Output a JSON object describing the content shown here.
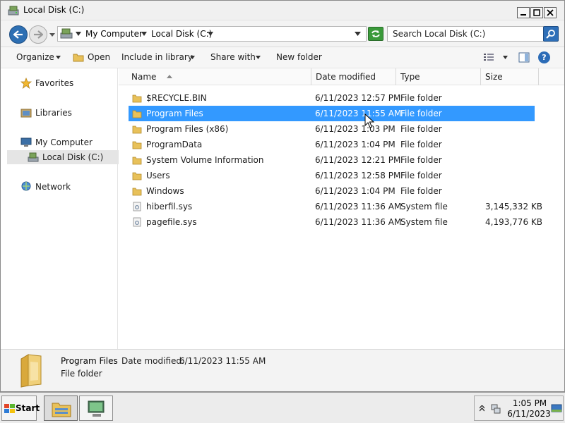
{
  "window": {
    "title": "Local Disk (C:)"
  },
  "address": {
    "crumbs": [
      "My Computer",
      "Local Disk (C:)"
    ],
    "search_placeholder": "Search Local Disk (C:)"
  },
  "toolbar": {
    "organize": "Organize",
    "open": "Open",
    "include_in_library": "Include in library",
    "share_with": "Share with",
    "new_folder": "New folder",
    "help_glyph": "?"
  },
  "nav": {
    "favorites": "Favorites",
    "libraries": "Libraries",
    "my_computer": "My Computer",
    "local_disk": "Local Disk (C:)",
    "network": "Network"
  },
  "columns": {
    "name": "Name",
    "date_modified": "Date modified",
    "type": "Type",
    "size": "Size"
  },
  "files": [
    {
      "name": "$RECYCLE.BIN",
      "date": "6/11/2023 12:57 PM",
      "type": "File folder",
      "size": "",
      "icon": "folder-icon"
    },
    {
      "name": "Program Files",
      "date": "6/11/2023 11:55 AM",
      "type": "File folder",
      "size": "",
      "icon": "folder-icon",
      "selected": true
    },
    {
      "name": "Program Files (x86)",
      "date": "6/11/2023 1:03 PM",
      "type": "File folder",
      "size": "",
      "icon": "folder-icon"
    },
    {
      "name": "ProgramData",
      "date": "6/11/2023 1:04 PM",
      "type": "File folder",
      "size": "",
      "icon": "folder-icon"
    },
    {
      "name": "System Volume Information",
      "date": "6/11/2023 12:21 PM",
      "type": "File folder",
      "size": "",
      "icon": "folder-icon"
    },
    {
      "name": "Users",
      "date": "6/11/2023 12:58 PM",
      "type": "File folder",
      "size": "",
      "icon": "folder-icon"
    },
    {
      "name": "Windows",
      "date": "6/11/2023 1:04 PM",
      "type": "File folder",
      "size": "",
      "icon": "folder-icon"
    },
    {
      "name": "hiberfil.sys",
      "date": "6/11/2023 11:36 AM",
      "type": "System file",
      "size": "3,145,332 KB",
      "icon": "system-file-icon"
    },
    {
      "name": "pagefile.sys",
      "date": "6/11/2023 11:36 AM",
      "type": "System file",
      "size": "4,193,776 KB",
      "icon": "system-file-icon"
    }
  ],
  "details": {
    "name": "Program Files",
    "modified_label": "Date modified:",
    "modified_value": "6/11/2023 11:55 AM",
    "type": "File folder"
  },
  "taskbar": {
    "start_label": "Start",
    "time": "1:05 PM",
    "date": "6/11/2023"
  },
  "colors": {
    "selection": "#3399ff",
    "folder": "#e8c15a",
    "accent": "#2d6fb3"
  }
}
